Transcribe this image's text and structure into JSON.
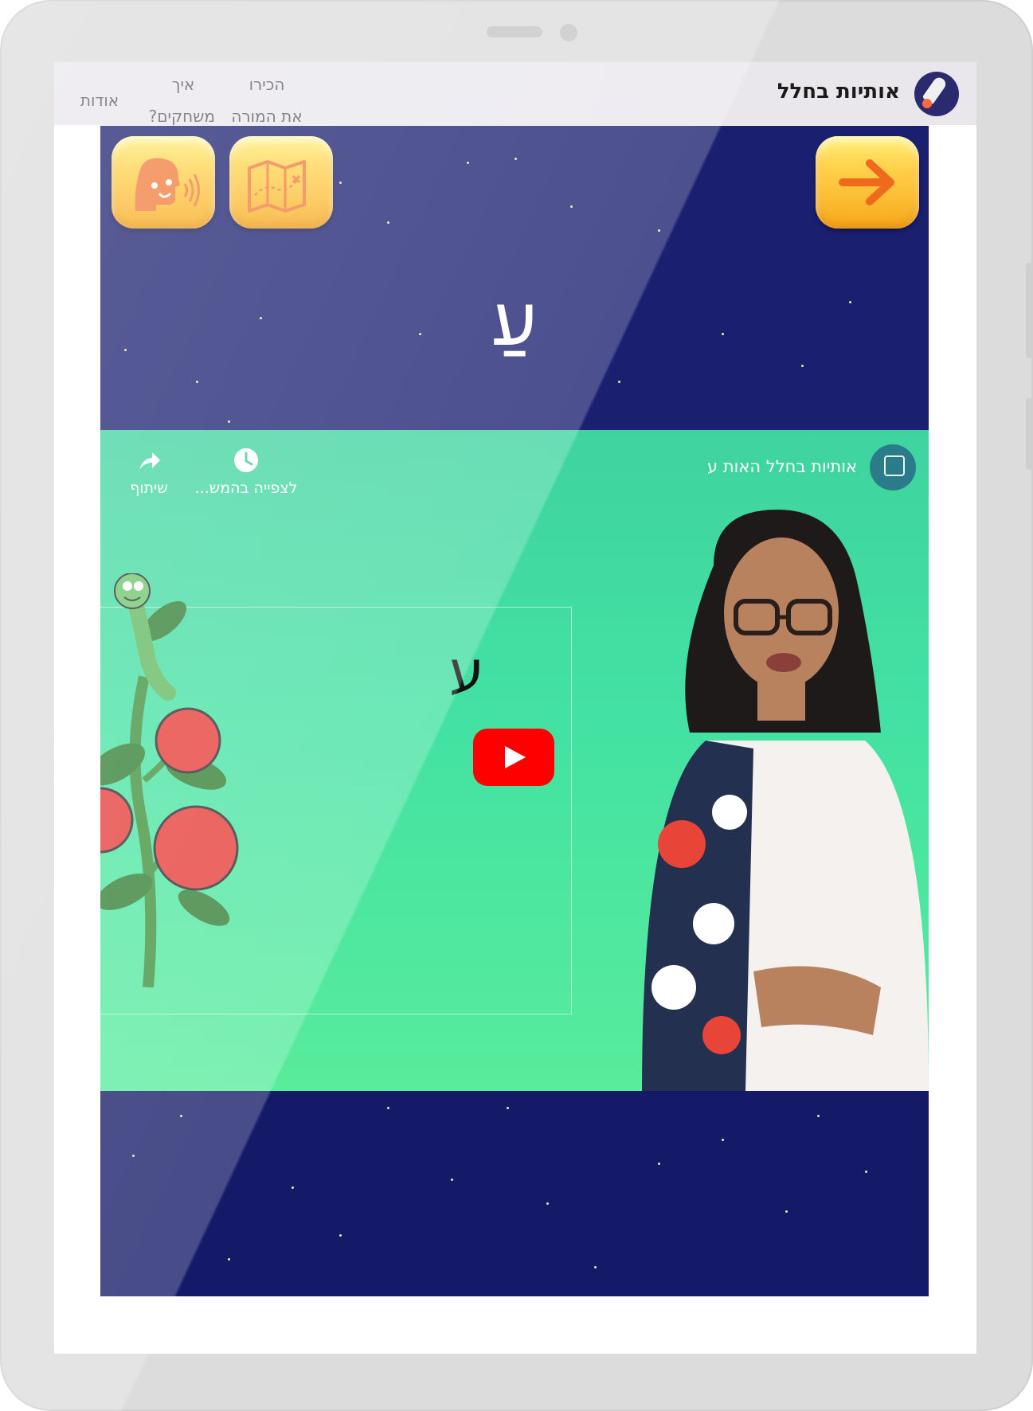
{
  "brand": {
    "name": "אותיות בחלל"
  },
  "nav": {
    "meet_teacher_line1": "הכירו",
    "meet_teacher_line2": "את המורה",
    "how_to_play_line1": "איך",
    "how_to_play_line2": "משחקים?",
    "about": "אודות"
  },
  "game": {
    "letter": "עַ",
    "buttons": {
      "listen_icon": "speaking-head-icon",
      "map_icon": "map-icon",
      "next_icon": "arrow-right-icon"
    }
  },
  "video": {
    "title": "אותיות בחלל האות ע",
    "watch_later": "לצפייה בהמש...",
    "share": "שיתוף",
    "board_letter": "ע"
  },
  "colors": {
    "button_gold": "#f7a81b",
    "space_navy": "#1a1f6f",
    "video_green": "#43e2a2",
    "youtube_red": "#ff0000"
  }
}
